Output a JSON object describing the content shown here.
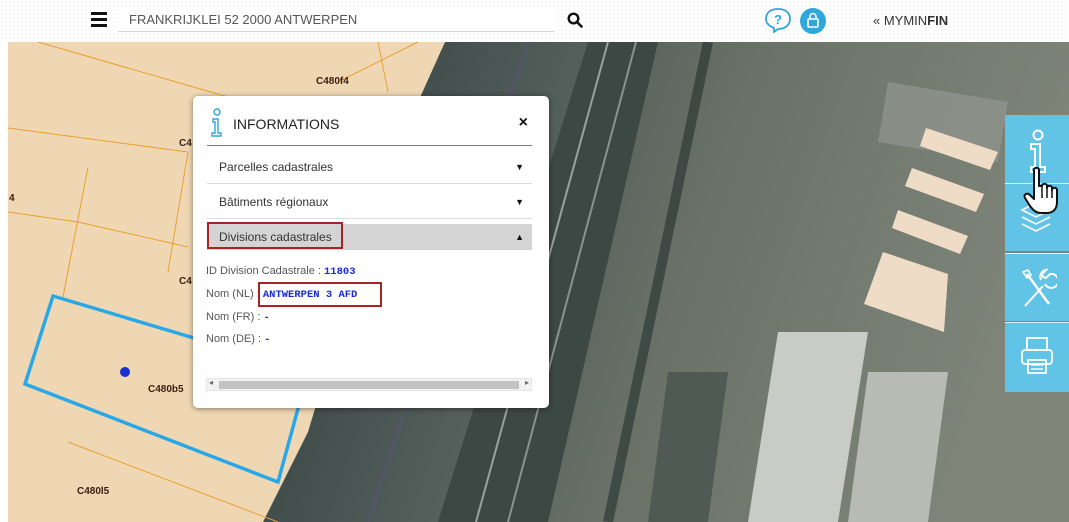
{
  "header": {
    "address_value": "FRANKRIJKLEI 52 2000 ANTWERPEN",
    "myminfin_prefix": "« MYMIN",
    "myminfin_bold": "FIN"
  },
  "icons": {
    "menu": "hamburger-menu-icon",
    "search": "search-icon",
    "help": "help-icon",
    "lock": "lock-icon",
    "info": "info-icon",
    "layers": "layers-icon",
    "tools": "tools-icon",
    "print": "print-icon",
    "cursor": "hand-cursor-icon"
  },
  "colors": {
    "tool_bg": "#61c3e6",
    "selected_parcel": "#29a8e8",
    "highlight_box": "#a52525",
    "value_text": "#1a2bd6",
    "parcel_fill": "#f0d7b3"
  },
  "map": {
    "parcel_labels": [
      "C480f4",
      "C4",
      "4",
      "C4",
      "C480b5",
      "C480l5"
    ]
  },
  "panel": {
    "title": "INFORMATIONS",
    "close": "×",
    "sections": [
      {
        "label": "Parcelles cadastrales",
        "state": "collapsed",
        "arrow": "▼"
      },
      {
        "label": "Bâtiments régionaux",
        "state": "collapsed",
        "arrow": "▼"
      },
      {
        "label": "Divisions cadastrales",
        "state": "expanded",
        "arrow": "▲"
      }
    ],
    "details": [
      {
        "label": "ID Division Cadastrale : ",
        "value": "11803"
      },
      {
        "label": "Nom (NL) : ",
        "value": "ANTWERPEN 3 AFD"
      },
      {
        "label": "Nom (FR) : ",
        "value": "-"
      },
      {
        "label": "Nom (DE) : ",
        "value": "-"
      }
    ],
    "scroll_left": "◂",
    "scroll_right": "▸"
  }
}
